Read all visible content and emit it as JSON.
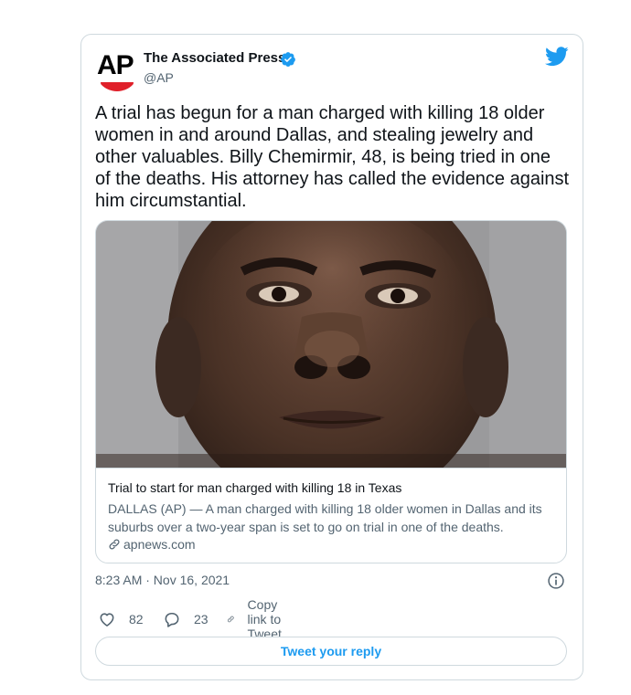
{
  "tweet": {
    "author": {
      "display_name": "The Associated Press",
      "handle": "@AP",
      "avatar_logo_text": "AP",
      "verified": true
    },
    "text": "A trial has begun for a man charged with killing 18 older women in and around Dallas, and stealing jewelry and other valuables. Billy Chemirmir, 48, is being tried in one of the deaths. His attorney has called the evidence against him circumstantial.",
    "link_card": {
      "image_icon": "mugshot-photo",
      "title": "Trial to start for man charged with killing 18 in Texas",
      "description": "DALLAS (AP) — A man charged with killing 18 older women in Dallas and its suburbs over a two-year span is set to go on trial in one of the deaths.",
      "domain": "apnews.com"
    },
    "timestamp": "8:23 AM · Nov 16, 2021",
    "actions": {
      "likes": "82",
      "replies": "23",
      "copy_link_label": "Copy link to Tweet"
    },
    "reply_button_label": "Tweet your reply"
  },
  "icons": {
    "brand": "twitter-bird-icon",
    "verified": "verified-badge-icon",
    "info": "info-icon",
    "like": "heart-icon",
    "reply": "reply-bubble-icon",
    "copy": "link-icon"
  },
  "colors": {
    "accent": "#1d9bf0",
    "text_primary": "#0f1419",
    "text_secondary": "#536471",
    "border": "#cfd9de",
    "ap_red": "#e0202a"
  }
}
